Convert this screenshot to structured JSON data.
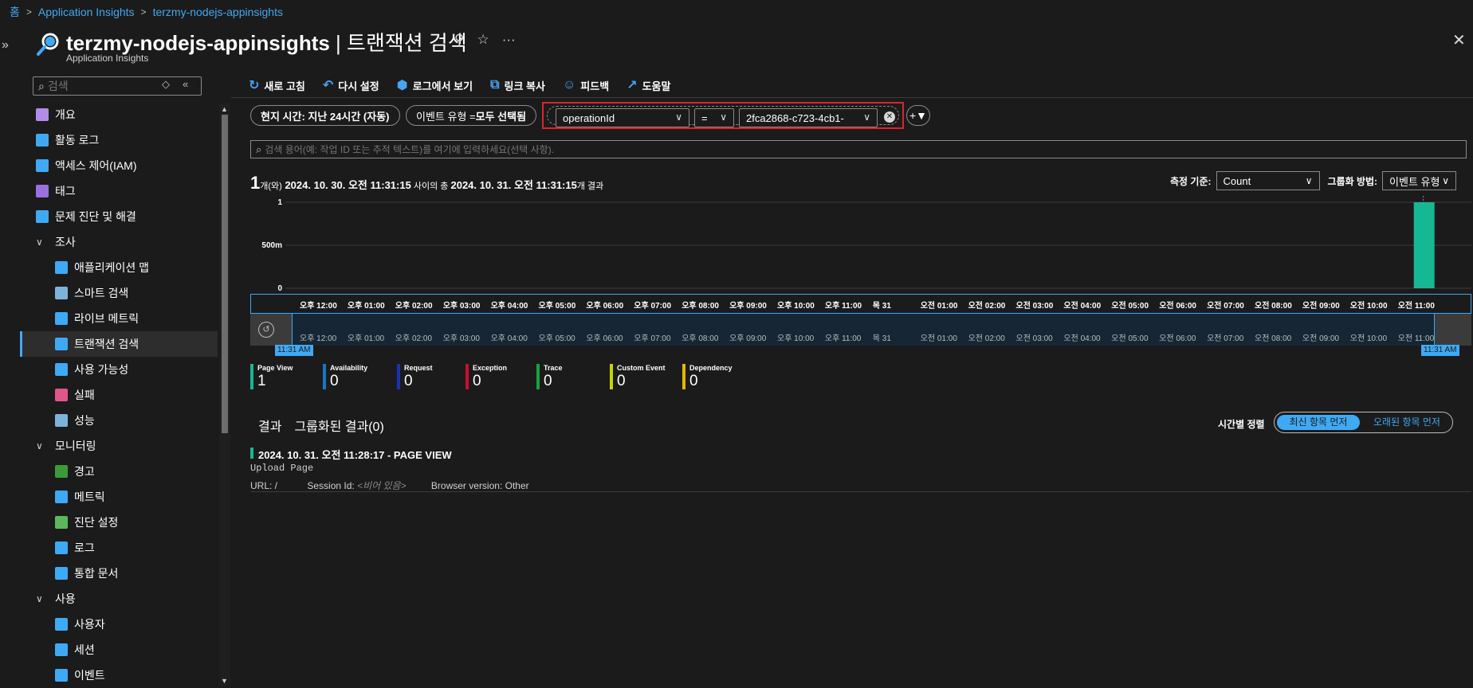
{
  "breadcrumb": [
    "홈",
    "Application Insights",
    "terzmy-nodejs-appinsights"
  ],
  "header": {
    "title": "terzmy-nodejs-appinsights",
    "title_sep": " | ",
    "title_page": "트랜잭션 검색",
    "subtitle": "Application Insights",
    "pin_icon": "pin-icon",
    "star_icon": "star-icon",
    "more_icon": "ellipsis-icon"
  },
  "sidebar": {
    "search_placeholder": "검색",
    "items": [
      {
        "label": "개요",
        "icon": "lightbulb-icon",
        "color": "#b28be8",
        "level": 0
      },
      {
        "label": "활동 로그",
        "icon": "activity-log-icon",
        "color": "#3fa9f5",
        "level": 0
      },
      {
        "label": "액세스 제어(IAM)",
        "icon": "people-icon",
        "color": "#3fa9f5",
        "level": 0
      },
      {
        "label": "태그",
        "icon": "tag-icon",
        "color": "#9b6fe0",
        "level": 0
      },
      {
        "label": "문제 진단 및 해결",
        "icon": "wrench-icon",
        "color": "#3fa9f5",
        "level": 0
      },
      {
        "label": "조사",
        "icon": "chevron-down-icon",
        "level": "group"
      },
      {
        "label": "애플리케이션 맵",
        "icon": "app-map-icon",
        "color": "#3fa9f5",
        "level": 1
      },
      {
        "label": "스마트 검색",
        "icon": "smart-detection-icon",
        "color": "#7fb2d8",
        "level": 1
      },
      {
        "label": "라이브 메트릭",
        "icon": "pulse-icon",
        "color": "#3fa9f5",
        "level": 1
      },
      {
        "label": "트랜잭션 검색",
        "icon": "search-icon",
        "color": "#3fa9f5",
        "level": 1,
        "active": true
      },
      {
        "label": "사용 가능성",
        "icon": "globe-icon",
        "color": "#3fa9f5",
        "level": 1
      },
      {
        "label": "실패",
        "icon": "failures-icon",
        "color": "#e0568a",
        "level": 1
      },
      {
        "label": "성능",
        "icon": "performance-icon",
        "color": "#7fb2d8",
        "level": 1
      },
      {
        "label": "모니터링",
        "icon": "chevron-down-icon",
        "level": "group"
      },
      {
        "label": "경고",
        "icon": "alert-icon",
        "color": "#3c9a3c",
        "level": 1
      },
      {
        "label": "메트릭",
        "icon": "metrics-icon",
        "color": "#3fa9f5",
        "level": 1
      },
      {
        "label": "진단 설정",
        "icon": "diagnostic-icon",
        "color": "#5cb85c",
        "level": 1
      },
      {
        "label": "로그",
        "icon": "logs-icon",
        "color": "#3fa9f5",
        "level": 1
      },
      {
        "label": "통합 문서",
        "icon": "workbook-icon",
        "color": "#3fa9f5",
        "level": 1
      },
      {
        "label": "사용",
        "icon": "chevron-down-icon",
        "level": "group"
      },
      {
        "label": "사용자",
        "icon": "user-icon",
        "color": "#3fa9f5",
        "level": 1
      },
      {
        "label": "세션",
        "icon": "session-icon",
        "color": "#3fa9f5",
        "level": 1
      },
      {
        "label": "이벤트",
        "icon": "event-icon",
        "color": "#3fa9f5",
        "level": 1
      }
    ]
  },
  "toolbar": [
    {
      "label": "새로 고침",
      "icon": "refresh-icon"
    },
    {
      "label": "다시 설정",
      "icon": "undo-icon"
    },
    {
      "label": "로그에서 보기",
      "icon": "logs-icon"
    },
    {
      "label": "링크 복사",
      "icon": "copy-icon"
    },
    {
      "label": "피드백",
      "icon": "feedback-icon"
    },
    {
      "label": "도움말",
      "icon": "external-link-icon"
    }
  ],
  "filters": {
    "time_pill": "현지 시간: 지난 24시간 (자동)",
    "event_pill_prefix": "이벤트 유형 = ",
    "event_pill_value": "모두 선택됨",
    "field": "operationId",
    "operator": "=",
    "value": "2fca2868-c723-4cb1-"
  },
  "search": {
    "placeholder": "검색 용어(예: 작업 ID 또는 추적 텍스트)를 여기에 입력하세요(선택 사항)."
  },
  "results_summary": {
    "count": "1",
    "count_suffix": "개(와)",
    "from": "2024. 10. 30. 오전 11:31:15",
    "between": " 사이의 총 ",
    "to": "2024. 10. 31. 오전 11:31:15",
    "suffix": "개 결과"
  },
  "measure": {
    "label": "측정 기준:",
    "value": "Count"
  },
  "groupby": {
    "label": "그룹화 방법:",
    "value": "이벤트 유형"
  },
  "chart_data": {
    "type": "bar",
    "yticks": [
      "1",
      "500m",
      "0"
    ],
    "ylim": [
      0,
      1
    ],
    "x": [
      "오후 12:00",
      "오후 01:00",
      "오후 02:00",
      "오후 03:00",
      "오후 04:00",
      "오후 05:00",
      "오후 06:00",
      "오후 07:00",
      "오후 08:00",
      "오후 09:00",
      "오후 10:00",
      "오후 11:00",
      "목 31",
      "오전 01:00",
      "오전 02:00",
      "오전 03:00",
      "오전 04:00",
      "오전 05:00",
      "오전 06:00",
      "오전 07:00",
      "오전 08:00",
      "오전 09:00",
      "오전 10:00",
      "오전 11:00"
    ],
    "series": [
      {
        "name": "Page View",
        "color": "#16b894",
        "bar_at": "오전 11:00",
        "value": 1
      }
    ]
  },
  "brush": {
    "start": "11:31 AM",
    "end": "11:31 AM"
  },
  "legend": [
    {
      "name": "Page View",
      "value": "1",
      "color": "#16b894"
    },
    {
      "name": "Availability",
      "value": "0",
      "color": "#1a74c8"
    },
    {
      "name": "Request",
      "value": "0",
      "color": "#1a2fbf"
    },
    {
      "name": "Exception",
      "value": "0",
      "color": "#c8102e"
    },
    {
      "name": "Trace",
      "value": "0",
      "color": "#1f9d46"
    },
    {
      "name": "Custom Event",
      "value": "0",
      "color": "#c7d400"
    },
    {
      "name": "Dependency",
      "value": "0",
      "color": "#e0b800"
    }
  ],
  "results": {
    "tab_results": "결과",
    "tab_grouped": "그룹화된 결과(0)",
    "sort_label": "시간별 정렬",
    "sort_newest": "최신 항목 먼저",
    "sort_oldest": "오래된 항목 먼저",
    "rows": [
      {
        "title": "2024. 10. 31. 오전 11:28:17 - PAGE VIEW",
        "name": "Upload Page",
        "url_label": "URL: /",
        "session_label": "Session Id: ",
        "session_value": "<비어 있음>",
        "browser": "Browser version: Other"
      }
    ]
  }
}
